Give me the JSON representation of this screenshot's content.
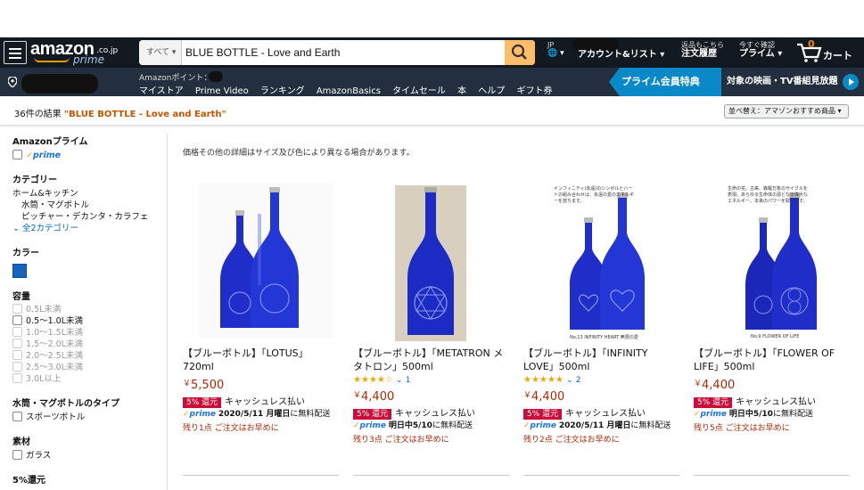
{
  "header": {
    "logo_text": "amazon",
    "logo_tld": ".co.jp",
    "logo_prime": "prime",
    "search_category": "すべて ▾",
    "search_value": "BLUE BOTTLE - Love and Earth",
    "lang": "JP",
    "lang_globe": "🌐 ▾",
    "account_label": "アカウント&リスト ▾",
    "returns_label_1": "返品もこちら",
    "returns_label_2": "注文履歴",
    "prime_label_1": "今すぐ確認",
    "prime_label_2": "プライム ▾",
    "cart_label": "カート",
    "cart_count": "0"
  },
  "subnav": {
    "points": "Amazonポイント：",
    "links": [
      "マイストア",
      "Prime Video",
      "ランキング",
      "AmazonBasics",
      "タイムセール",
      "本",
      "ヘルプ",
      "ギフト券"
    ],
    "banner": "プライム会員特典",
    "banner2": "対象の映画・TV番組見放題"
  },
  "results": {
    "count_text": "36件の結果",
    "query": "\"BLUE BOTTLE - Love and Earth\"",
    "sort_label": "並べ替え：アマゾンおすすめ商品 ▾",
    "note": "価格その他の詳細はサイズ及び色により異なる場合があります。"
  },
  "sidebar": {
    "prime_head": "Amazonプライム",
    "prime_item": "prime",
    "cat_head": "カテゴリー",
    "cats": [
      "ホーム&キッチン",
      "水筒・マグボトル",
      "ピッチャー・デカンタ・カラフェ"
    ],
    "cat_more": "全2カテゴリー",
    "color_head": "カラー",
    "vol_head": "容量",
    "vols": [
      "0.5L未満",
      "0.5～1.0L未満",
      "1.0～1.5L未満",
      "1.5～2.0L未満",
      "2.0～2.5L未満",
      "2.5～3.0L未満",
      "3.0L以上"
    ],
    "type_head": "水筒・マグボトルのタイプ",
    "type_item": "スポーツボトル",
    "mat_head": "素材",
    "mat_item": "ガラス",
    "rebate_head": "5%還元",
    "swatch_color": "#1565c0"
  },
  "products": [
    {
      "title": "【ブルーボトル】「LOTUS」720ml",
      "price_symbol": "￥",
      "price": "5,500",
      "badge": "5% 還元",
      "cashless": "キャッシュレス払い",
      "prime": "prime",
      "ship_date": "2020/5/11 月曜日",
      "ship_suffix": "に無料配送",
      "stock": "残り1点 ご注文はお早めに"
    },
    {
      "title": "【ブルーボトル】「METATRON メタトロン」500ml",
      "stars": "★★★★☆",
      "rating_count": "1",
      "price_symbol": "￥",
      "price": "4,400",
      "badge": "5% 還元",
      "cashless": "キャッシュレス払い",
      "prime": "prime",
      "ship_date": "明日中5/10",
      "ship_suffix": "に無料配送",
      "stock": "残り3点 ご注文はお早めに"
    },
    {
      "title": "【ブルーボトル】「INFINITY LOVE」500ml",
      "stars": "★★★★★",
      "rating_count": "2",
      "price_symbol": "￥",
      "price": "4,400",
      "badge": "5% 還元",
      "cashless": "キャッシュレス払い",
      "prime": "prime",
      "ship_date": "2020/5/11 月曜日",
      "ship_suffix": "に無料配送",
      "stock": "残り2点 ご注文はお早めに",
      "img_caption": "No.13 INFINITY HEART 無限の愛",
      "img_text": "インフィニティ(永遠)のシンボルとハートの組み合わせは、永遠の愛のエネルギーを放ちます。"
    },
    {
      "title": "【ブルーボトル】「FLOWER OF LIFE」500ml",
      "price_symbol": "￥",
      "price": "4,400",
      "badge": "5% 還元",
      "cashless": "キャッシュレス払い",
      "prime": "prime",
      "ship_date": "明日中5/10",
      "ship_suffix": "に無料配送",
      "stock": "残り5点 ご注文はお早めに",
      "img_caption": "No.9 FLOWER OF LIFE",
      "img_text": "生命の花。古来、森羅万象のサイクルを表現。あらゆる生命体の源となる偉大なエネルギー。本来のパワーを取り戻す。"
    }
  ]
}
